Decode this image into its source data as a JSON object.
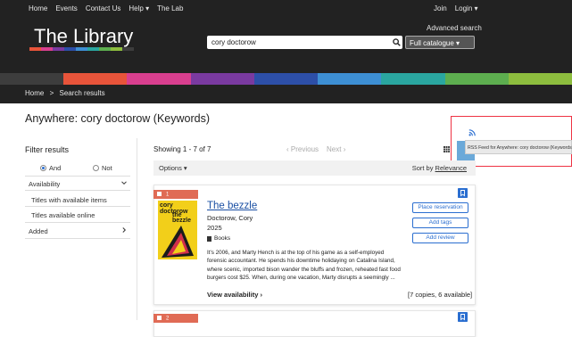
{
  "topnav": {
    "left": [
      "Home",
      "Events",
      "Contact Us",
      "Help ▾",
      "The Lab"
    ],
    "right": [
      "Join",
      "Login ▾"
    ]
  },
  "logo": "The Library",
  "search": {
    "value": "cory doctorow",
    "advanced": "Advanced search",
    "scope": "Full catalogue ▾"
  },
  "colors": {
    "rainbow": [
      "#3d3d3d",
      "#e8543a",
      "#d93f8f",
      "#7a3aa0",
      "#2d4fa8",
      "#3d8fd4",
      "#2aa6a0",
      "#5dae4f",
      "#8dbd3e"
    ],
    "link": "#1a4fa3",
    "accent": "#2a6ed0",
    "tag": "#e06b55"
  },
  "breadcrumb": [
    "Home",
    ">",
    "Search results"
  ],
  "page_title": "Anywhere: cory doctorow (Keywords)",
  "rss_tooltip": "RSS Feed for Anywhere: cory doctorow (Keywords)",
  "filters": {
    "heading": "Filter results",
    "and_label": "And",
    "or_label": "Not",
    "availability": "Availability",
    "options": [
      "Titles with available items",
      "Titles available online"
    ],
    "added": "Added"
  },
  "results": {
    "showing": "Showing 1 - 7 of 7",
    "prev": "‹  Previous",
    "next": "Next  ›",
    "options": "Options ▾",
    "sort_prefix": "Sort by ",
    "sort_value": "Relevance"
  },
  "items": [
    {
      "number": "1",
      "title": "The bezzle",
      "author": "Doctorow, Cory",
      "year": "2025",
      "format": "Books",
      "cover_line1": "cory\ndoctorow",
      "cover_line2": "the\nbezzle",
      "description": "It's 2006, and Marty Hench is at the top of his game as a self-employed forensic accountant. He spends his downtime holidaying on Catalina Island, where scenic, imported bison wander the bluffs and frozen, reheated fast food burgers cost $25. When, during one vacation, Marty disrupts a seemingly ...",
      "availability": "View availability ›",
      "copies": "[7 copies, 6 available]",
      "actions": [
        "Place reservation",
        "Add tags",
        "Add review"
      ]
    },
    {
      "number": "2"
    }
  ]
}
